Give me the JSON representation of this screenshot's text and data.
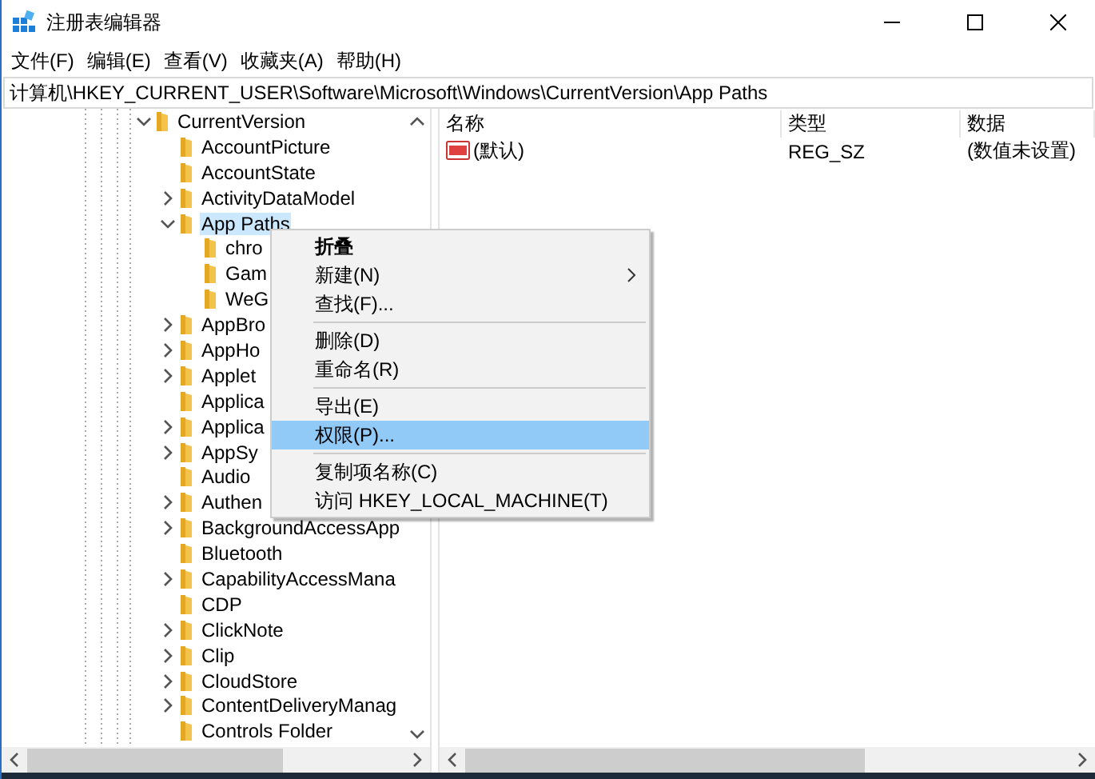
{
  "window": {
    "title": "注册表编辑器"
  },
  "menu": [
    "文件(F)",
    "编辑(E)",
    "查看(V)",
    "收藏夹(A)",
    "帮助(H)"
  ],
  "address": "计算机\\HKEY_CURRENT_USER\\Software\\Microsoft\\Windows\\CurrentVersion\\App Paths",
  "tree": [
    {
      "label": "CurrentVersion",
      "expanded": true,
      "selected": false,
      "children": [
        {
          "label": "AccountPicture",
          "selected": false
        },
        {
          "label": "AccountState",
          "selected": false
        },
        {
          "label": "ActivityDataModel",
          "expanded": false,
          "selected": false
        },
        {
          "label": "App Paths",
          "expanded": true,
          "selected": true,
          "children": [
            {
              "label": "chro",
              "selected": false
            },
            {
              "label": "Gam",
              "selected": false
            },
            {
              "label": "WeG",
              "selected": false
            }
          ]
        },
        {
          "label": "AppBro",
          "expanded": false,
          "selected": false
        },
        {
          "label": "AppHo",
          "expanded": false,
          "selected": false
        },
        {
          "label": "Applet",
          "expanded": false,
          "selected": false
        },
        {
          "label": "Applica",
          "selected": false
        },
        {
          "label": "Applica",
          "expanded": false,
          "selected": false
        },
        {
          "label": "AppSy",
          "expanded": false,
          "selected": false
        },
        {
          "label": "Audio",
          "selected": false
        },
        {
          "label": "Authen",
          "expanded": false,
          "selected": false
        },
        {
          "label": "BackgroundAccessApp",
          "expanded": false,
          "selected": false
        },
        {
          "label": "Bluetooth",
          "selected": false
        },
        {
          "label": "CapabilityAccessMana",
          "expanded": false,
          "selected": false
        },
        {
          "label": "CDP",
          "selected": false
        },
        {
          "label": "ClickNote",
          "expanded": false,
          "selected": false
        },
        {
          "label": "Clip",
          "expanded": false,
          "selected": false
        },
        {
          "label": "CloudStore",
          "expanded": false,
          "selected": false
        },
        {
          "label": "ContentDeliveryManag",
          "expanded": false,
          "selected": false
        },
        {
          "label": "Controls Folder",
          "selected": false
        }
      ]
    }
  ],
  "values": {
    "columns": [
      "名称",
      "类型",
      "数据"
    ],
    "rows": [
      {
        "name": "(默认)",
        "type": "REG_SZ",
        "data": "(数值未设置)"
      }
    ]
  },
  "context_menu": [
    {
      "kind": "item",
      "label": "折叠",
      "bold": true,
      "highlighted": false,
      "submenu": false
    },
    {
      "kind": "item",
      "label": "新建(N)",
      "bold": false,
      "highlighted": false,
      "submenu": true
    },
    {
      "kind": "item",
      "label": "查找(F)...",
      "bold": false,
      "highlighted": false,
      "submenu": false
    },
    {
      "kind": "separator"
    },
    {
      "kind": "item",
      "label": "删除(D)",
      "bold": false,
      "highlighted": false,
      "submenu": false
    },
    {
      "kind": "item",
      "label": "重命名(R)",
      "bold": false,
      "highlighted": false,
      "submenu": false
    },
    {
      "kind": "separator"
    },
    {
      "kind": "item",
      "label": "导出(E)",
      "bold": false,
      "highlighted": false,
      "submenu": false
    },
    {
      "kind": "item",
      "label": "权限(P)...",
      "bold": false,
      "highlighted": true,
      "submenu": false
    },
    {
      "kind": "separator"
    },
    {
      "kind": "item",
      "label": "复制项名称(C)",
      "bold": false,
      "highlighted": false,
      "submenu": false
    },
    {
      "kind": "item",
      "label": "访问 HKEY_LOCAL_MACHINE(T)",
      "bold": false,
      "highlighted": false,
      "submenu": false
    }
  ]
}
